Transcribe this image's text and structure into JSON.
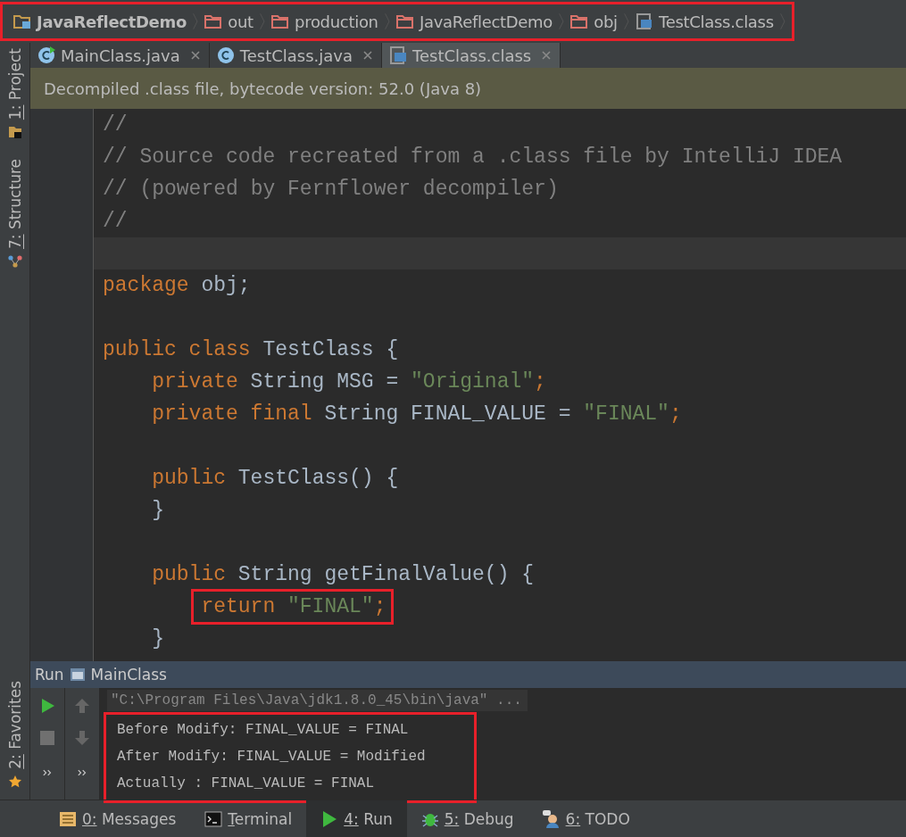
{
  "breadcrumb": {
    "highlighted": true,
    "items": [
      {
        "kind": "project",
        "label": "JavaReflectDemo"
      },
      {
        "kind": "folder",
        "label": "out"
      },
      {
        "kind": "folder",
        "label": "production"
      },
      {
        "kind": "folder",
        "label": "JavaReflectDemo"
      },
      {
        "kind": "folder",
        "label": "obj"
      },
      {
        "kind": "classfile",
        "label": "TestClass.class"
      }
    ]
  },
  "side_tabs_top": [
    {
      "kind": "project",
      "label": "1: Project"
    },
    {
      "kind": "structure",
      "label": "7: Structure"
    }
  ],
  "side_tabs_bottom": [
    {
      "kind": "favorites",
      "label": "2: Favorites"
    }
  ],
  "editor_tabs": [
    {
      "kind": "runclass",
      "label": "MainClass.java",
      "selected": false
    },
    {
      "kind": "class",
      "label": "TestClass.java",
      "selected": false
    },
    {
      "kind": "classfile",
      "label": "TestClass.class",
      "selected": true
    }
  ],
  "notice": "Decompiled .class file, bytecode version: 52.0 (Java 8)",
  "code_lines": [
    {
      "kind": "code",
      "tokens": [
        {
          "kind": "comment",
          "text": "//"
        }
      ]
    },
    {
      "kind": "code",
      "tokens": [
        {
          "kind": "comment",
          "text": "// Source code recreated from a .class file by IntelliJ IDEA"
        }
      ]
    },
    {
      "kind": "code",
      "tokens": [
        {
          "kind": "comment",
          "text": "// (powered by Fernflower decompiler)"
        }
      ]
    },
    {
      "kind": "code",
      "tokens": [
        {
          "kind": "comment",
          "text": "//"
        }
      ]
    },
    {
      "kind": "caret_line"
    },
    {
      "kind": "code",
      "tokens": [
        {
          "kind": "keyword",
          "text": "package "
        },
        {
          "kind": "plain",
          "text": "obj;"
        }
      ]
    },
    {
      "kind": "blank"
    },
    {
      "kind": "code",
      "tokens": [
        {
          "kind": "keyword",
          "text": "public class "
        },
        {
          "kind": "plain",
          "text": "TestClass {"
        }
      ],
      "children": [
        {
          "kind": "code",
          "tokens": [
            {
              "kind": "keyword",
              "text": "private "
            },
            {
              "kind": "plain",
              "text": "String MSG = "
            },
            {
              "kind": "string",
              "text": "\"Original\""
            },
            {
              "kind": "keyword",
              "text": ";"
            }
          ]
        },
        {
          "kind": "code",
          "tokens": [
            {
              "kind": "keyword",
              "text": "private final "
            },
            {
              "kind": "plain",
              "text": "String FINAL_VALUE = "
            },
            {
              "kind": "string",
              "text": "\"FINAL\""
            },
            {
              "kind": "keyword",
              "text": ";"
            }
          ]
        },
        {
          "kind": "blank"
        },
        {
          "kind": "code",
          "tokens": [
            {
              "kind": "keyword",
              "text": "public "
            },
            {
              "kind": "plain",
              "text": "TestClass() {"
            }
          ]
        },
        {
          "kind": "code",
          "tokens": [
            {
              "kind": "plain",
              "text": "}"
            }
          ]
        },
        {
          "kind": "blank"
        },
        {
          "kind": "code",
          "tokens": [
            {
              "kind": "keyword",
              "text": "public "
            },
            {
              "kind": "plain",
              "text": "String getFinalValue() {"
            }
          ],
          "children": [
            {
              "kind": "code",
              "highlighted": true,
              "tokens": [
                {
                  "kind": "keyword",
                  "text": "return "
                },
                {
                  "kind": "string",
                  "text": "\"FINAL\""
                },
                {
                  "kind": "keyword",
                  "text": ";"
                }
              ]
            }
          ]
        },
        {
          "kind": "code",
          "tokens": [
            {
              "kind": "plain",
              "text": "}"
            }
          ]
        }
      ]
    }
  ],
  "run_panel": {
    "label": "Run",
    "config": "MainClass",
    "command": "\"C:\\Program Files\\Java\\jdk1.8.0_45\\bin\\java\" ...",
    "output_highlighted": true,
    "output": [
      "Before Modify: FINAL_VALUE = FINAL",
      "After Modify: FINAL_VALUE = Modified",
      "Actually : FINAL_VALUE = FINAL"
    ]
  },
  "bottom_tabs": [
    {
      "kind": "messages",
      "label": "0: Messages",
      "selected": false
    },
    {
      "kind": "terminal",
      "label": "Terminal",
      "selected": false
    },
    {
      "kind": "run",
      "label": "4: Run",
      "selected": true
    },
    {
      "kind": "debug",
      "label": "5: Debug",
      "selected": false
    },
    {
      "kind": "todo",
      "label": "6: TODO",
      "selected": false
    }
  ]
}
